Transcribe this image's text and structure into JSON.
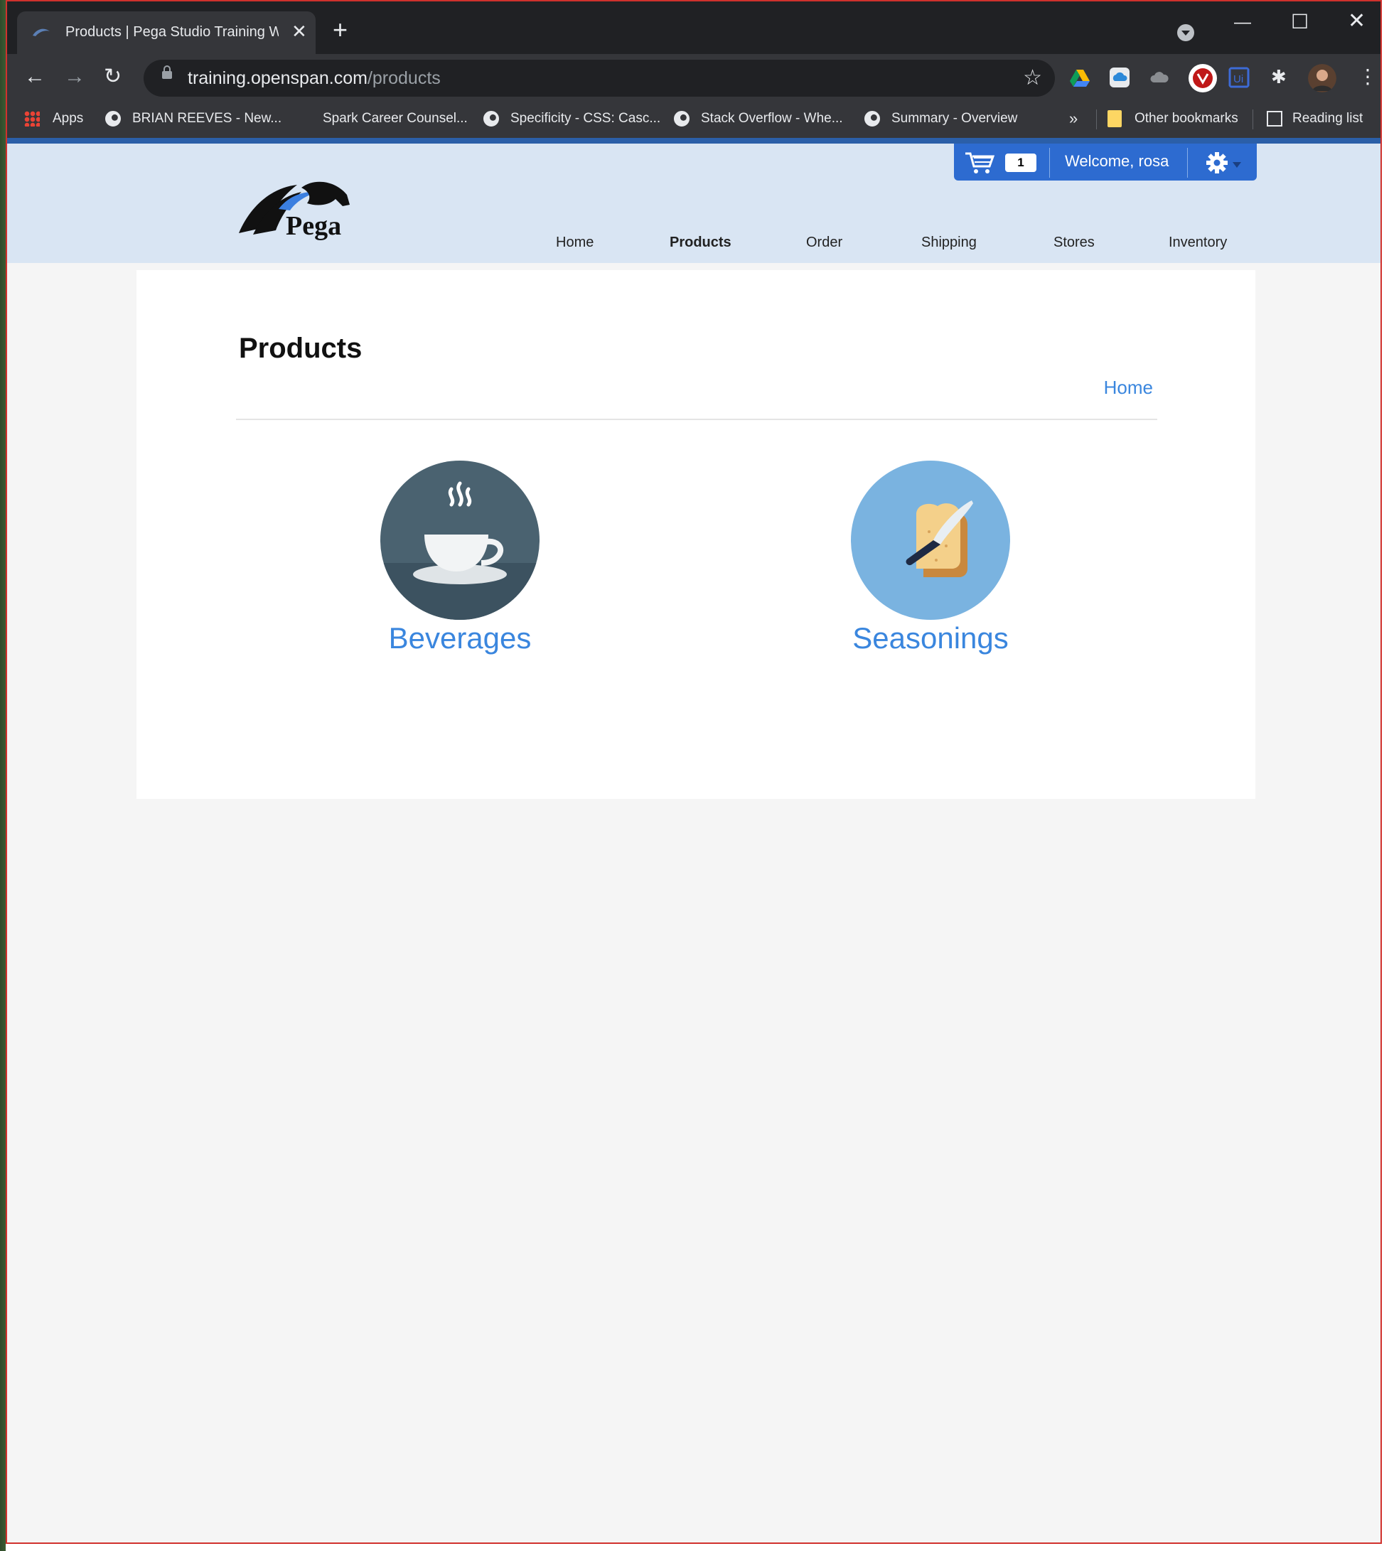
{
  "browser": {
    "tab_title": "Products | Pega Studio Training Web",
    "url_host": "training.openspan.com",
    "url_path": "/products",
    "bookmarks": [
      {
        "label": "Apps"
      },
      {
        "label": "BRIAN REEVES - New..."
      },
      {
        "label": "Spark Career Counsel..."
      },
      {
        "label": "Specificity - CSS: Casc..."
      },
      {
        "label": "Stack Overflow - Whe..."
      },
      {
        "label": "Summary - Overview"
      }
    ],
    "overflow": "»",
    "other_bookmarks": "Other bookmarks",
    "reading_list": "Reading list"
  },
  "site": {
    "logo_text": "Pega",
    "cart_count": "1",
    "welcome": "Welcome, rosa",
    "nav": [
      {
        "label": "Home"
      },
      {
        "label": "Products"
      },
      {
        "label": "Order"
      },
      {
        "label": "Shipping"
      },
      {
        "label": "Stores"
      },
      {
        "label": "Inventory"
      }
    ],
    "active_nav": "Products",
    "brand_blue": "#2d6bd0",
    "link_blue": "#3a86de"
  },
  "main": {
    "title": "Products",
    "breadcrumb": "Home",
    "categories": [
      {
        "label": "Beverages",
        "icon": "coffee-cup-icon",
        "bg": "#4a6270"
      },
      {
        "label": "Seasonings",
        "icon": "bread-knife-icon",
        "bg": "#7ab3e0"
      }
    ]
  }
}
